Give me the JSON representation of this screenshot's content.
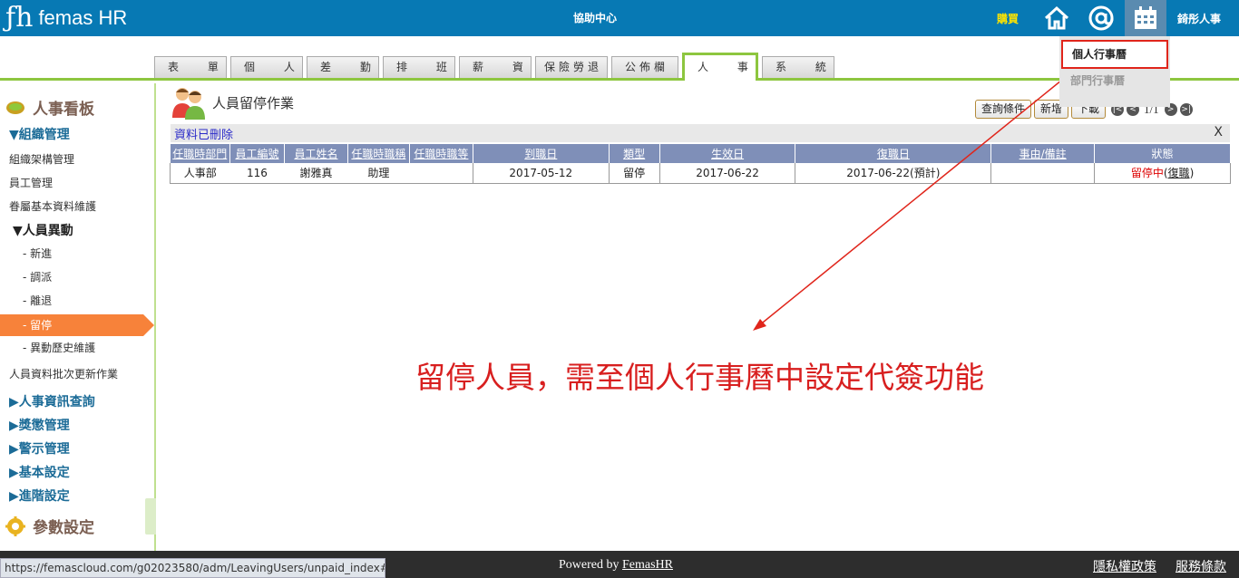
{
  "header": {
    "logo_text": "femas HR",
    "help_center": "協助中心",
    "buy": "購買",
    "user": "錡彤人事"
  },
  "tabs": [
    "表 單",
    "個 人",
    "差 勤",
    "排 班",
    "薪 資",
    "保險勞退",
    "公佈欄",
    "人 事",
    "系 統"
  ],
  "active_tab": "人 事",
  "calendar_menu": {
    "personal": "個人行事曆",
    "department": "部門行事曆"
  },
  "sidebar": {
    "title": "人事看板",
    "org_group": "▼組織管理",
    "org_items": [
      "組織架構管理",
      "員工管理",
      "眷屬基本資料維護"
    ],
    "movement_group": "▼人員異動",
    "movement_items": [
      "- 新進",
      "- 調派",
      "- 離退",
      "- 留停",
      "- 異動歷史維護"
    ],
    "active_item": "- 留停",
    "batch_update": "人員資料批次更新作業",
    "groups": [
      "▶人事資訊查詢",
      "▶獎懲管理",
      "▶警示管理",
      "▶基本設定",
      "▶進階設定"
    ],
    "settings": "參數設定"
  },
  "page": {
    "title": "人員留停作業",
    "buttons": {
      "query": "查詢條件",
      "add": "新增",
      "download": "下載"
    },
    "pager": "1/1",
    "message": "資料已刪除",
    "close": "X"
  },
  "table": {
    "headers": [
      "任職時部門",
      "員工編號",
      "員工姓名",
      "任職時職稱",
      "任職時職等",
      "到職日",
      "類型",
      "生效日",
      "復職日",
      "事由/備註",
      "狀態"
    ],
    "rows": [
      {
        "dept": "人事部",
        "emp_no": "116",
        "name": "謝雅真",
        "title": "助理",
        "grade": "",
        "hire_date": "2017-05-12",
        "type": "留停",
        "effective": "2017-06-22",
        "return": "2017-06-22(預計)",
        "reason": "",
        "status": "留停中",
        "status_link": "復職"
      }
    ]
  },
  "annotation": "留停人員，需至個人行事曆中設定代簽功能",
  "footer": {
    "status_url": "https://femascloud.com/g02023580/adm/LeavingUsers/unpaid_index#",
    "powered_prefix": "Powered by",
    "powered_link": "FemasHR",
    "privacy": "隱私權政策",
    "terms": "服務條款"
  },
  "colors": {
    "topbar": "#0779b4",
    "accent_green": "#8dc63f",
    "active_orange": "#f7823a",
    "annotation_red": "#d81f1f"
  }
}
